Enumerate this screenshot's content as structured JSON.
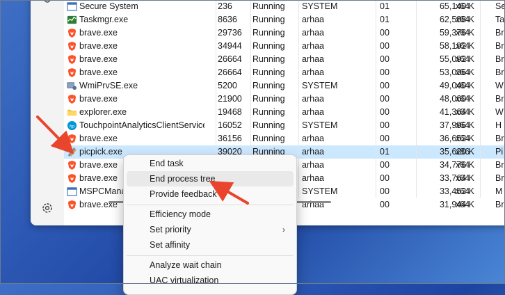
{
  "processes": [
    {
      "name": "Secure System",
      "pid": "236",
      "status": "Running",
      "user": "SYSTEM",
      "cpu": "01",
      "memory": "65,140 K",
      "arch": "x64",
      "desc": "Se",
      "icon": "system-window-icon"
    },
    {
      "name": "Taskmgr.exe",
      "pid": "8636",
      "status": "Running",
      "user": "arhaa",
      "cpu": "01",
      "memory": "62,588 K",
      "arch": "x64",
      "desc": "Ta",
      "icon": "task-manager-icon"
    },
    {
      "name": "brave.exe",
      "pid": "29736",
      "status": "Running",
      "user": "arhaa",
      "cpu": "00",
      "memory": "59,376 K",
      "arch": "x64",
      "desc": "Br",
      "icon": "brave-icon"
    },
    {
      "name": "brave.exe",
      "pid": "34944",
      "status": "Running",
      "user": "arhaa",
      "cpu": "00",
      "memory": "58,192 K",
      "arch": "x64",
      "desc": "Br",
      "icon": "brave-icon"
    },
    {
      "name": "brave.exe",
      "pid": "26664",
      "status": "Running",
      "user": "arhaa",
      "cpu": "00",
      "memory": "55,092 K",
      "arch": "x64",
      "desc": "Br",
      "icon": "brave-icon"
    },
    {
      "name": "brave.exe",
      "pid": "26664",
      "status": "Running",
      "user": "arhaa",
      "cpu": "00",
      "memory": "53,036 K",
      "arch": "x64",
      "desc": "Br",
      "icon": "brave-icon"
    },
    {
      "name": "WmiPrvSE.exe",
      "pid": "5200",
      "status": "Running",
      "user": "SYSTEM",
      "cpu": "00",
      "memory": "49,040 K",
      "arch": "x64",
      "desc": "W",
      "icon": "wmi-icon"
    },
    {
      "name": "brave.exe",
      "pid": "21900",
      "status": "Running",
      "user": "arhaa",
      "cpu": "00",
      "memory": "48,060 K",
      "arch": "x64",
      "desc": "Br",
      "icon": "brave-icon"
    },
    {
      "name": "explorer.exe",
      "pid": "19468",
      "status": "Running",
      "user": "arhaa",
      "cpu": "00",
      "memory": "41,364 K",
      "arch": "x64",
      "desc": "W",
      "icon": "folder-icon"
    },
    {
      "name": "TouchpointAnalyticsClientService...",
      "pid": "16052",
      "status": "Running",
      "user": "SYSTEM",
      "cpu": "00",
      "memory": "37,996 K",
      "arch": "x64",
      "desc": "H",
      "icon": "hp-icon"
    },
    {
      "name": "brave.exe",
      "pid": "36156",
      "status": "Running",
      "user": "arhaa",
      "cpu": "00",
      "memory": "36,652 K",
      "arch": "x64",
      "desc": "Br",
      "icon": "brave-icon"
    },
    {
      "name": "picpick.exe",
      "pid": "39020",
      "status": "Running",
      "user": "arhaa",
      "cpu": "01",
      "memory": "35,620 K",
      "arch": "x86",
      "desc": "Pi",
      "icon": "picpick-icon"
    },
    {
      "name": "brave.exe",
      "pid": "",
      "status": "",
      "user": "arhaa",
      "cpu": "00",
      "memory": "34,776 K",
      "arch": "x64",
      "desc": "Br",
      "icon": "brave-icon"
    },
    {
      "name": "brave.exe",
      "pid": "",
      "status": "",
      "user": "arhaa",
      "cpu": "00",
      "memory": "33,764 K",
      "arch": "x64",
      "desc": "Br",
      "icon": "brave-icon"
    },
    {
      "name": "MSPCManager",
      "pid": "",
      "status": "",
      "user": "SYSTEM",
      "cpu": "00",
      "memory": "33,452 K",
      "arch": "x64",
      "desc": "M",
      "icon": "system-window-icon"
    },
    {
      "name": "brave.exe",
      "pid": "",
      "status": "",
      "user": "arhaa",
      "cpu": "00",
      "memory": "31,944 K",
      "arch": "x64",
      "desc": "Br",
      "icon": "brave-icon"
    }
  ],
  "context_menu": {
    "end_task": "End task",
    "end_process_tree": "End process tree",
    "provide_feedback": "Provide feedback",
    "efficiency_mode": "Efficiency mode",
    "set_priority": "Set priority",
    "set_affinity": "Set affinity",
    "analyze_wait_chain": "Analyze wait chain",
    "uac_virtualization": "UAC virtualization",
    "submenu_chevron": "›"
  },
  "colors": {
    "selected_row": "#cce8ff",
    "arrow": "#e8452c",
    "brave": "#fb542b"
  }
}
